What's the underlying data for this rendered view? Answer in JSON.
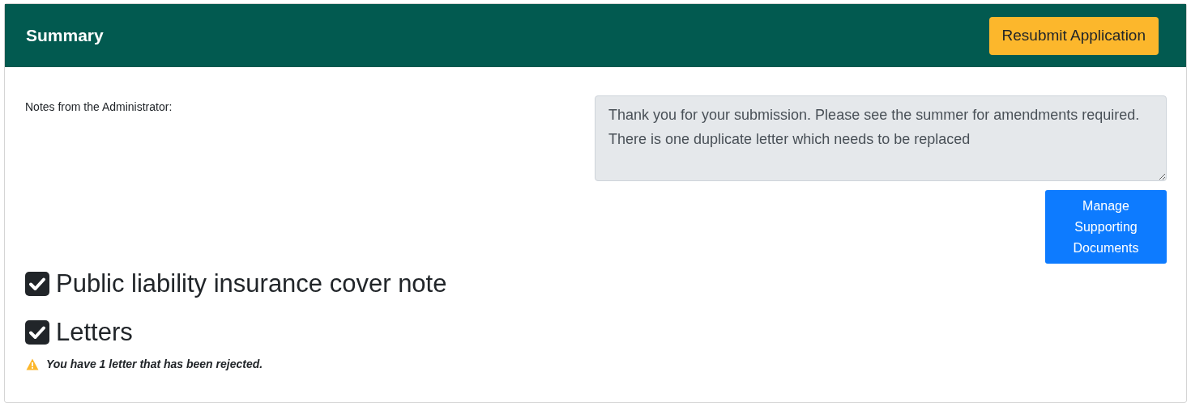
{
  "header": {
    "title": "Summary",
    "action": "Resubmit Application"
  },
  "notes": {
    "label": "Notes from the Administrator:",
    "value": "Thank you for your submission. Please see the summer for amendments required. There is one duplicate letter which needs to be replaced"
  },
  "manage_button": "Manage Supporting Documents",
  "checklist": [
    {
      "label": "Public liability insurance cover note",
      "checked": true
    },
    {
      "label": "Letters",
      "checked": true,
      "warning": "You have 1 letter that has been rejected."
    }
  ]
}
